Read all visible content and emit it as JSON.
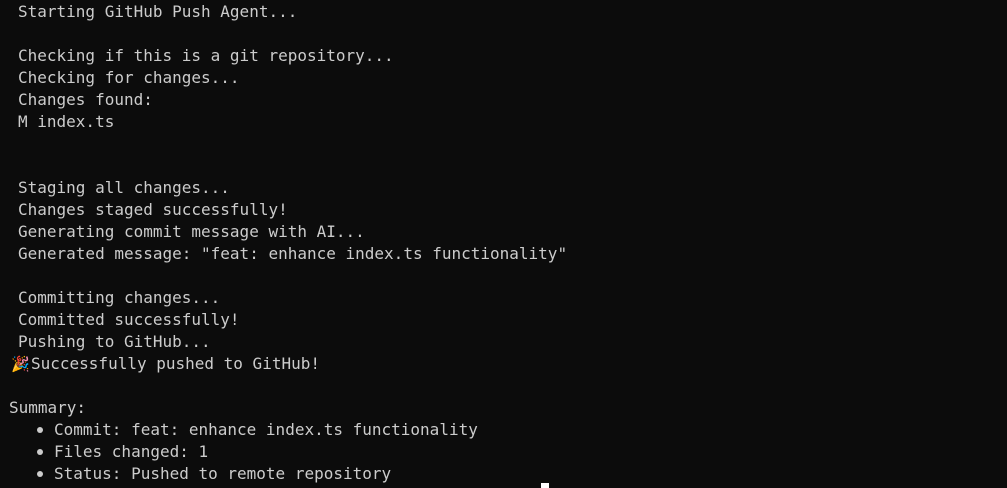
{
  "terminal": {
    "lines": {
      "l0": "Starting GitHub Push Agent...",
      "l1": "Checking if this is a git repository...",
      "l2": "Checking for changes...",
      "l3": "Changes found:",
      "l4": "M index.ts",
      "l5": "Staging all changes...",
      "l6": "Changes staged successfully!",
      "l7": "Generating commit message with AI...",
      "l8": "Generated message: \"feat: enhance index.ts functionality\"",
      "l9": "Committing changes...",
      "l10": "Committed successfully!",
      "l11": "Pushing to GitHub...",
      "l12": "Successfully pushed to GitHub!"
    },
    "success_emoji": "🎉",
    "summary": {
      "heading": "Summary:",
      "items": [
        "Commit: feat: enhance index.ts functionality",
        "Files changed: 1",
        "Status: Pushed to remote repository"
      ]
    }
  }
}
